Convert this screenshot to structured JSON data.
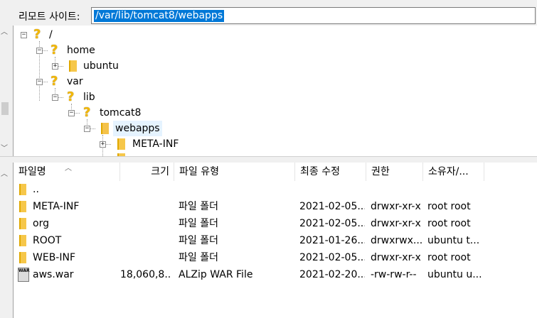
{
  "path_bar": {
    "label": "리모트 사이트:",
    "value": "/var/lib/tomcat8/webapps"
  },
  "tree": {
    "nodes": [
      {
        "label": "/",
        "icon": "question-folder-icon",
        "expander": "−"
      },
      {
        "label": "home",
        "icon": "question-folder-icon",
        "expander": "−"
      },
      {
        "label": "ubuntu",
        "icon": "folder-icon",
        "expander": "+"
      },
      {
        "label": "var",
        "icon": "question-folder-icon",
        "expander": "−"
      },
      {
        "label": "lib",
        "icon": "question-folder-icon",
        "expander": "−"
      },
      {
        "label": "tomcat8",
        "icon": "question-folder-icon",
        "expander": "−"
      },
      {
        "label": "webapps",
        "icon": "folder-icon",
        "expander": "−"
      },
      {
        "label": "META-INF",
        "icon": "folder-icon",
        "expander": "+"
      }
    ]
  },
  "file_list": {
    "columns": [
      "파일명",
      "크기",
      "파일 유형",
      "최종 수정",
      "권한",
      "소유자/..."
    ],
    "rows": [
      {
        "name": "..",
        "size": "",
        "type": "",
        "modified": "",
        "perms": "",
        "owner": "",
        "icon": "folder-icon"
      },
      {
        "name": "META-INF",
        "size": "",
        "type": "파일 폴더",
        "modified": "2021-02-05...",
        "perms": "drwxr-xr-x",
        "owner": "root root",
        "icon": "folder-icon"
      },
      {
        "name": "org",
        "size": "",
        "type": "파일 폴더",
        "modified": "2021-02-05...",
        "perms": "drwxr-xr-x",
        "owner": "root root",
        "icon": "folder-icon"
      },
      {
        "name": "ROOT",
        "size": "",
        "type": "파일 폴더",
        "modified": "2021-01-26...",
        "perms": "drwxrwx...",
        "owner": "ubuntu t...",
        "icon": "folder-icon"
      },
      {
        "name": "WEB-INF",
        "size": "",
        "type": "파일 폴더",
        "modified": "2021-02-05...",
        "perms": "drwxr-xr-x",
        "owner": "root root",
        "icon": "folder-icon"
      },
      {
        "name": "aws.war",
        "size": "18,060,8...",
        "type": "ALZip WAR File",
        "modified": "2021-02-20...",
        "perms": "-rw-rw-r--",
        "owner": "ubuntu u...",
        "icon": "war-file-icon"
      }
    ]
  }
}
